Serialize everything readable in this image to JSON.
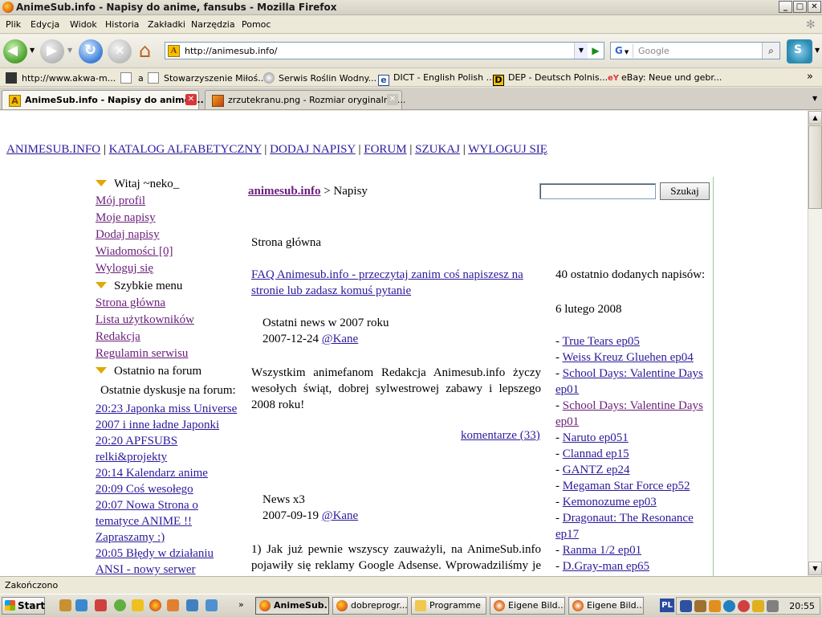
{
  "window": {
    "title": "AnimeSub.info - Napisy do anime, fansubs - Mozilla Firefox",
    "controls": [
      "_",
      "□",
      "✕"
    ]
  },
  "menu": [
    "Plik",
    "Edycja",
    "Widok",
    "Historia",
    "Zakładki",
    "Narzędzia",
    "Pomoc"
  ],
  "toolbar": {
    "url": "http://animesub.info/",
    "search_placeholder": "Google",
    "search_engine_letter": "G"
  },
  "bookmarks": [
    "http://www.akwa-m...",
    "a",
    "Stowarzyszenie Miłoś...",
    "Serwis Roślin Wodny...",
    "DICT - English Polish ...",
    "DEP - Deutsch Polnis...",
    "eBay: Neue und gebr..."
  ],
  "bookmarks_overflow": "»",
  "tabs": [
    {
      "label": "AnimeSub.info - Napisy do anime,..."
    },
    {
      "label": "zrzutekranu.png - Rozmiar oryginalny ..."
    }
  ],
  "page": {
    "topnav": [
      "ANIMESUB.INFO",
      "KATALOG ALFABETYCZNY",
      "DODAJ NAPISY",
      "FORUM",
      "SZUKAJ",
      "WYLOGUJ SIĘ"
    ],
    "topnav_sep": "|",
    "sidebar": {
      "welcome": "Witaj ~neko_",
      "user_links": [
        "Mój profil",
        "Moje napisy",
        "Dodaj napisy",
        "Wiadomości [0]",
        "Wyloguj się"
      ],
      "quick_menu_title": "Szybkie menu",
      "quick_links": [
        "Strona główna",
        "Lista użytkowników",
        "Redakcja",
        "Regulamin serwisu"
      ],
      "forum_title": "Ostatnio na forum",
      "forum_subtitle": "Ostatnie dyskusje na forum:",
      "forum_lines": [
        "20:23 Japonka miss Universe",
        "2007 i inne ładne Japonki",
        "20:20 APFSUBS",
        "relki&projekty",
        "20:14 Kalendarz anime",
        "20:09 Coś wesołego",
        "20:07 Nowa Strona o",
        "tematyce ANIME !!",
        "Zapraszamy :)",
        "20:05 Błędy w działaniu",
        "ANSI - nowy serwer"
      ]
    },
    "breadcrumb": {
      "home": "animesub.info",
      "rest": "> Napisy"
    },
    "search_button": "Szukaj",
    "main": {
      "heading": "Strona główna",
      "faq_lines": [
        "FAQ Animesub.info - przeczytaj zanim coś napiszesz na",
        "stronie lub zadasz komuś pytanie"
      ],
      "news1_title": "Ostatni news w 2007 roku",
      "news1_date": "2007-12-24",
      "news1_author": "@Kane",
      "news1_body": [
        "Wszystkim animefanom Redakcja Animesub.info życzy",
        "wesołych świąt, dobrej sylwestrowej zabawy i lepszego",
        "2008 roku!"
      ],
      "comments": "komentarze (33)",
      "news2_title": "News x3",
      "news2_date": "2007-09-19",
      "news2_author": "@Kane",
      "news2_body": [
        "1) Jak już pewnie wszyscy zauważyli, na AnimeSub.info",
        "pojawiły się reklamy Google Adsense. Wprowadziliśmy je"
      ]
    },
    "right": {
      "title": "40 ostatnio dodanych napisów:",
      "date": "6 lutego 2008",
      "dash": "-",
      "items": [
        "True Tears ep05",
        "Weiss Kreuz Gluehen ep04",
        "School Days: Valentine Days",
        "ep01",
        "School Days: Valentine Days",
        "ep01",
        "Naruto ep051",
        "Clannad ep15",
        "GANTZ ep24",
        "Megaman Star Force ep52",
        "Kemonozume ep03",
        "Dragonaut: The Resonance",
        "ep17",
        "Ranma 1/2 ep01",
        "D.Gray-man ep65"
      ]
    }
  },
  "status": "Zakończono",
  "taskbar": {
    "start": "Start",
    "buttons": [
      "AnimeSub...",
      "dobreprogr...",
      "Programme",
      "Eigene Bild...",
      "Eigene Bild..."
    ],
    "language": "PL",
    "clock": "20:55"
  }
}
